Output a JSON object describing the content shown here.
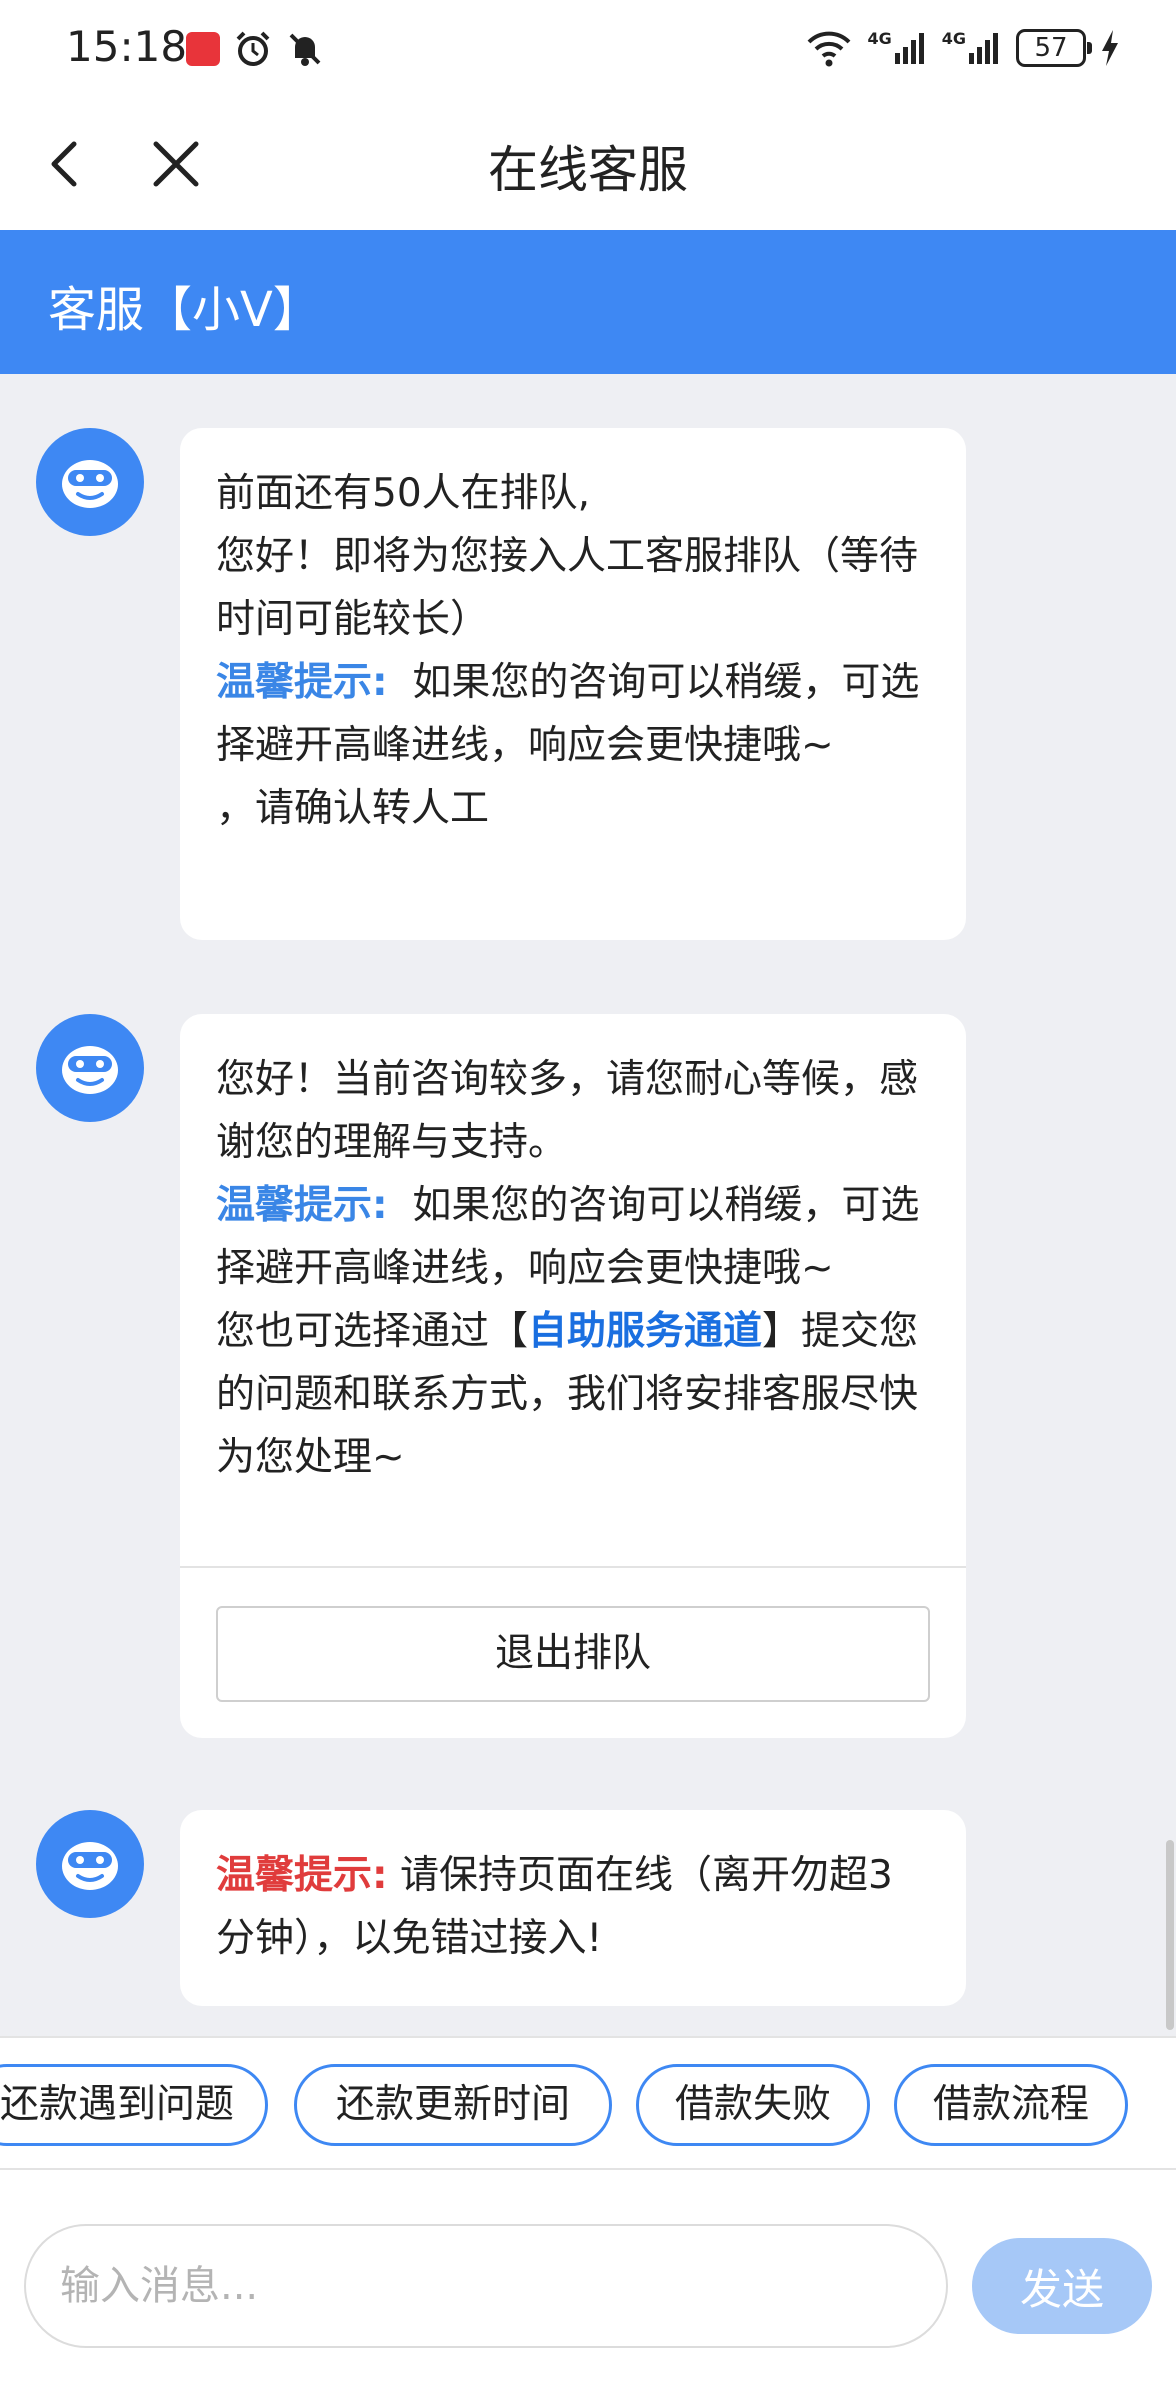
{
  "status_bar": {
    "time": "15:18",
    "network_1": "4G",
    "network_2": "4G",
    "battery": "57"
  },
  "nav": {
    "title": "在线客服"
  },
  "banner": {
    "agent_name": "客服【小V】"
  },
  "messages": [
    {
      "lines": [
        "前面还有50人在排队,",
        "您好！即将为您接入人工客服排队（等待时间可能较长）"
      ],
      "tip_label": "温馨提示:",
      "tip_text": "如果您的咨询可以稍缓，可选择避开高峰进线，响应会更快捷哦~",
      "closing": "，请确认转人工"
    },
    {
      "lines": [
        "您好！当前咨询较多，请您耐心等候，感谢您的理解与支持。"
      ],
      "tip_label": "温馨提示:",
      "tip_text": "如果您的咨询可以稍缓，可选择避开高峰进线，响应会更快捷哦~",
      "self_service_before": "您也可选择通过【",
      "self_service_link": "自助服务通道",
      "self_service_after": "】提交您的问题和联系方式，我们将安排客服尽快为您处理~",
      "button": "退出排队"
    },
    {
      "tip_label": "温馨提示:",
      "tip_text": "请保持页面在线（离开勿超3分钟），以免错过接入!"
    }
  ],
  "quick_replies": [
    "还款遇到问题",
    "还款更新时间",
    "借款失败",
    "借款流程"
  ],
  "input": {
    "placeholder": "输入消息...",
    "send": "发送"
  },
  "colors": {
    "accent": "#3e88f3",
    "tip_blue": "#3a86e6",
    "tip_red": "#e03c3c",
    "send_disabled": "#a6c8f7"
  }
}
